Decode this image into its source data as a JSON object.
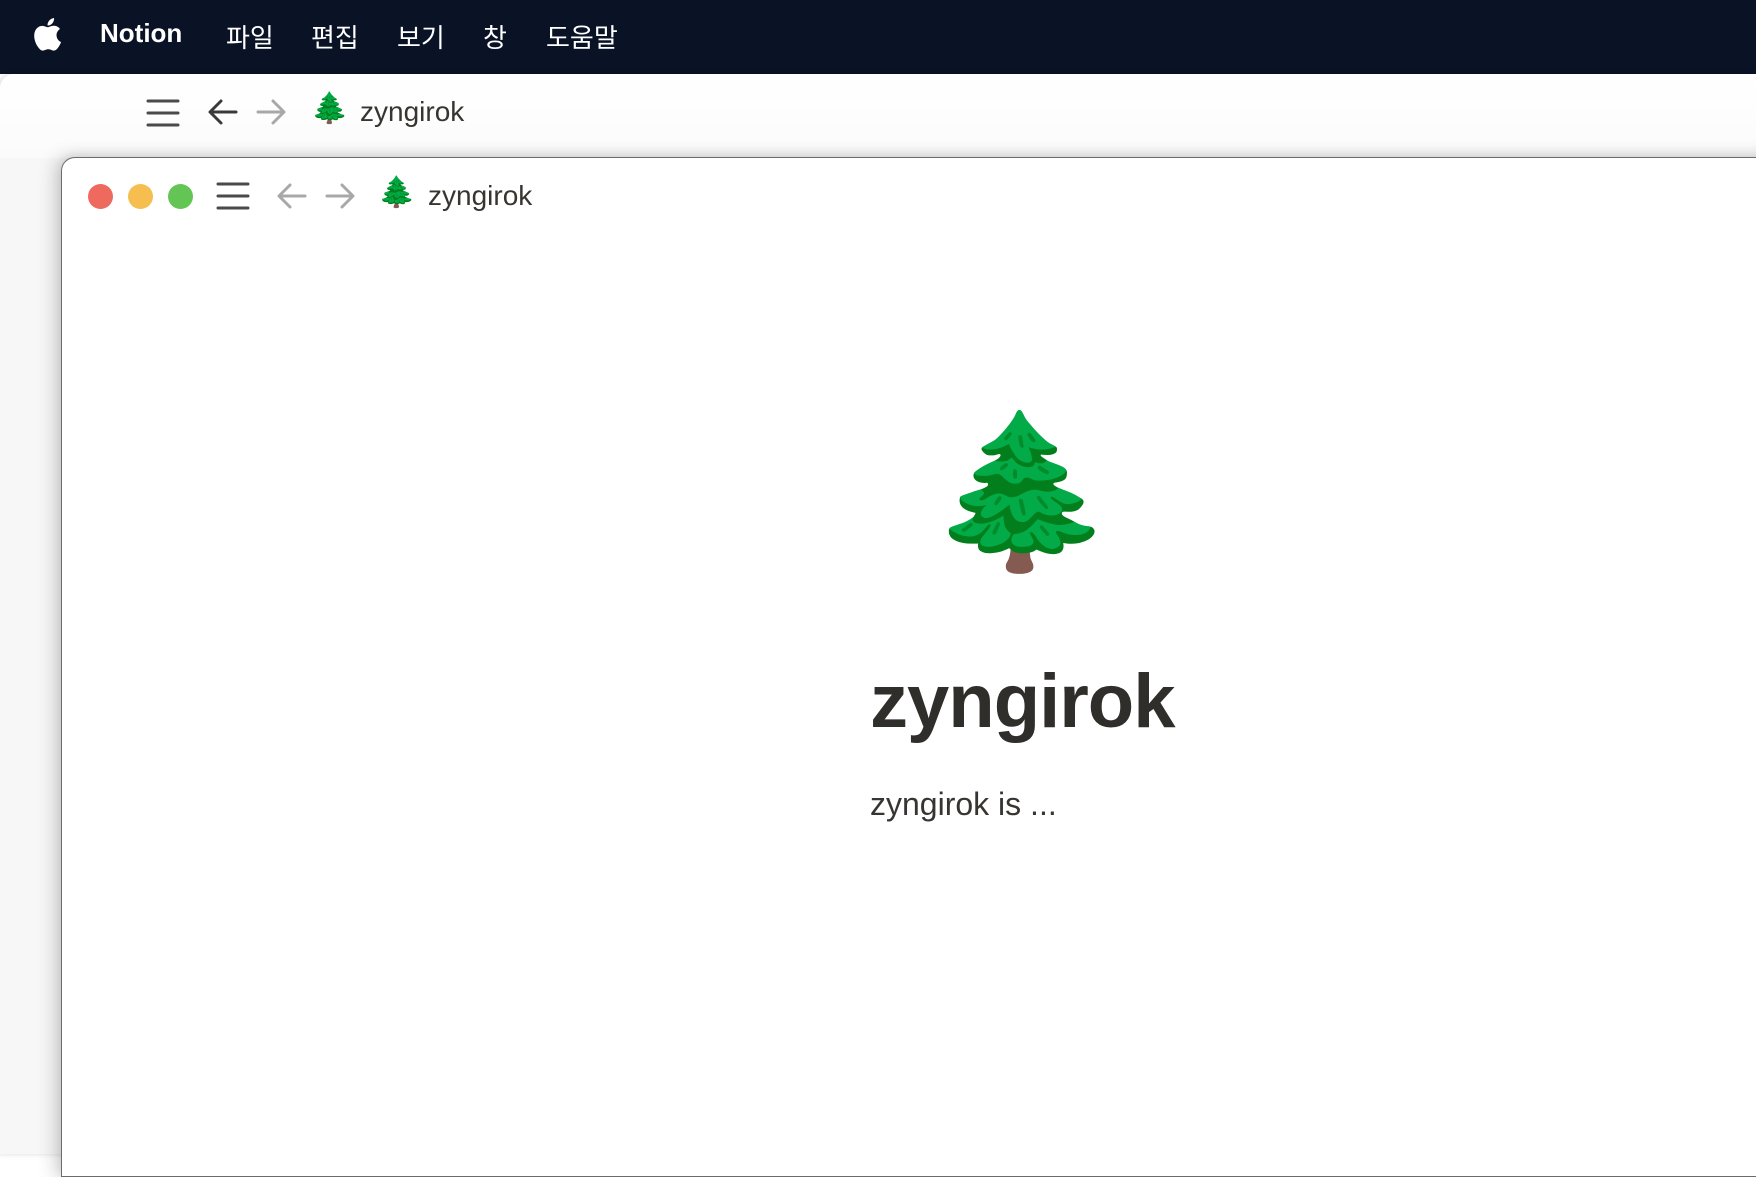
{
  "menubar": {
    "app_name": "Notion",
    "items": [
      {
        "label": "파일"
      },
      {
        "label": "편집"
      },
      {
        "label": "보기"
      },
      {
        "label": "창"
      },
      {
        "label": "도움말"
      }
    ]
  },
  "outer_window": {
    "breadcrumb": {
      "icon": "🌲",
      "title": "zyngirok"
    }
  },
  "inner_window": {
    "breadcrumb": {
      "icon": "🌲",
      "title": "zyngirok"
    },
    "traffic_lights": {
      "close": "#ee6a5f",
      "minimize": "#f5be4f",
      "maximize": "#62c554"
    }
  },
  "page": {
    "icon": "🌲",
    "title": "zyngirok",
    "body": "zyngirok is ..."
  },
  "icons": {
    "apple": "apple-logo-icon",
    "sidebar": "hamburger-menu-icon",
    "back": "arrow-left-icon",
    "forward": "arrow-right-icon"
  }
}
